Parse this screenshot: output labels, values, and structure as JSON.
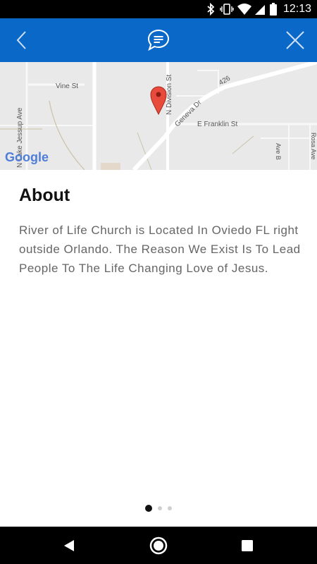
{
  "status_bar": {
    "time": "12:13"
  },
  "map": {
    "streets": [
      "Vine St",
      "N Lake Jessup Ave",
      "N Division St",
      "Geneva Dr",
      "E Franklin St",
      "Ave B",
      "Rosa Ave"
    ],
    "route_number": "426",
    "attribution": "Google"
  },
  "about": {
    "title": "About",
    "text": "River of Life Church is Located In Oviedo FL right outside Orlando. The Reason We Exist Is To Lead People To The Life Changing Love of Jesus."
  },
  "pager": {
    "page_count": 3,
    "active_page": 1
  }
}
